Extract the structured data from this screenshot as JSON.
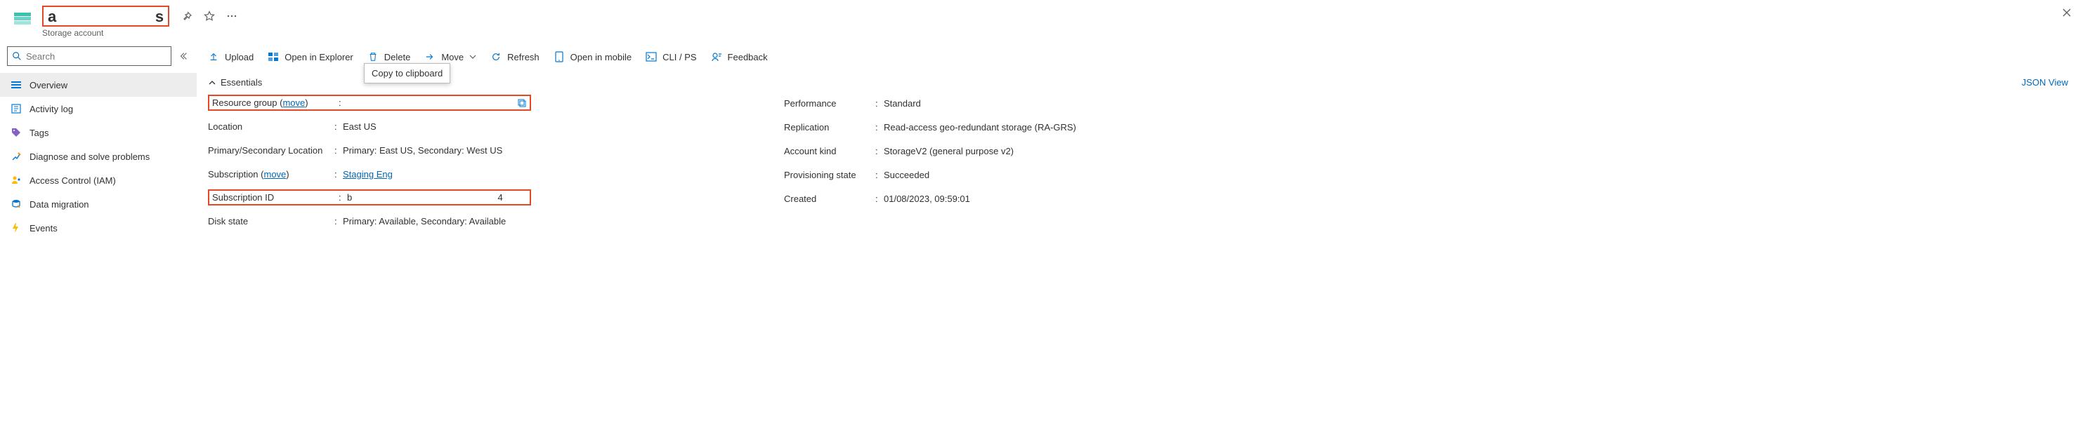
{
  "header": {
    "title_prefix": "a",
    "title_suffix": "s",
    "subtitle": "Storage account"
  },
  "search": {
    "placeholder": "Search"
  },
  "sidebar": {
    "items": [
      {
        "label": "Overview"
      },
      {
        "label": "Activity log"
      },
      {
        "label": "Tags"
      },
      {
        "label": "Diagnose and solve problems"
      },
      {
        "label": "Access Control (IAM)"
      },
      {
        "label": "Data migration"
      },
      {
        "label": "Events"
      }
    ]
  },
  "toolbar": {
    "upload": "Upload",
    "open_explorer": "Open in Explorer",
    "delete": "Delete",
    "move": "Move",
    "refresh": "Refresh",
    "open_mobile": "Open in mobile",
    "cli": "CLI / PS",
    "feedback": "Feedback"
  },
  "tooltip": "Copy to clipboard",
  "essentials": {
    "title": "Essentials",
    "json_view": "JSON View",
    "left": {
      "resource_group_label": "Resource group (",
      "resource_group_move": "move",
      "resource_group_label_end": ")",
      "resource_group_value": "",
      "location_label": "Location",
      "location_value": "East US",
      "primary_secondary_label": "Primary/Secondary Location",
      "primary_secondary_value": "Primary: East US, Secondary: West US",
      "subscription_label": "Subscription (",
      "subscription_move": "move",
      "subscription_label_end": ")",
      "subscription_value": "Staging Eng",
      "subscription_id_label": "Subscription ID",
      "subscription_id_prefix": "b",
      "subscription_id_suffix": "4",
      "disk_state_label": "Disk state",
      "disk_state_value": "Primary: Available, Secondary: Available"
    },
    "right": {
      "performance_label": "Performance",
      "performance_value": "Standard",
      "replication_label": "Replication",
      "replication_value": "Read-access geo-redundant storage (RA-GRS)",
      "account_kind_label": "Account kind",
      "account_kind_value": "StorageV2 (general purpose v2)",
      "provisioning_label": "Provisioning state",
      "provisioning_value": "Succeeded",
      "created_label": "Created",
      "created_value": "01/08/2023, 09:59:01"
    }
  }
}
